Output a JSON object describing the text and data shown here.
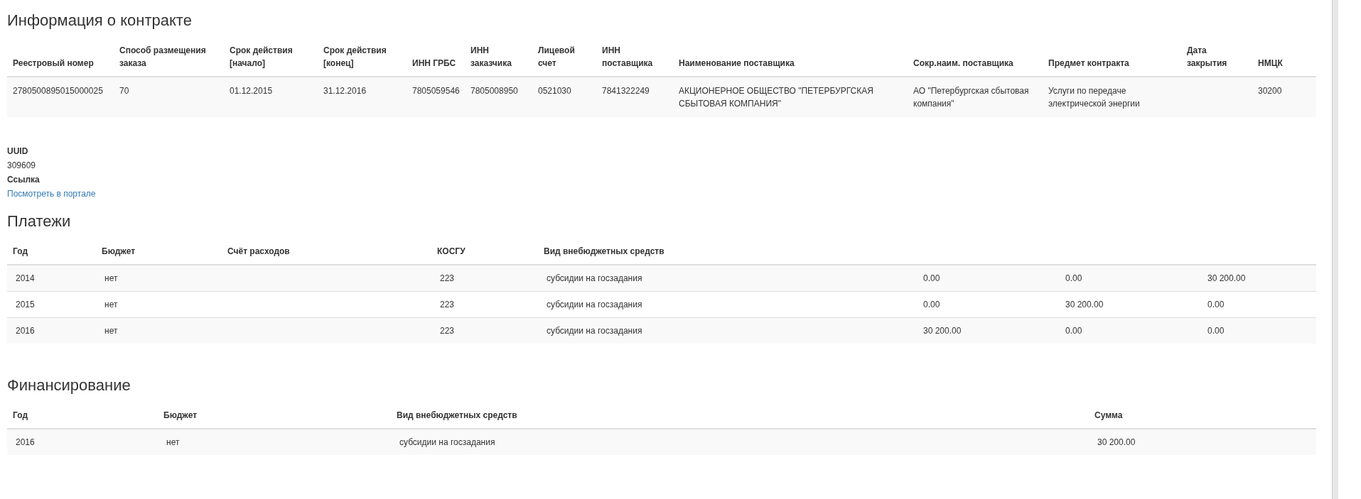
{
  "contract": {
    "title": "Информация о контракте",
    "columns": [
      "Реестровый номер",
      "Способ размещения заказа",
      "Срок действия [начало]",
      "Срок действия [конец]",
      "ИНН ГРБС",
      "ИНН заказчика",
      "Лицевой счет",
      "ИНН поставщика",
      "Наименование поставщика",
      "Сокр.наим. поставщика",
      "Предмет контракта",
      "Дата закрытия",
      "НМЦК"
    ],
    "rows": [
      {
        "registry_number": "2780500895015000025",
        "placement_method": "70",
        "start": "01.12.2015",
        "end": "31.12.2016",
        "inn_grbs": "7805059546",
        "inn_customer": "7805008950",
        "account": "0521030",
        "inn_supplier": "7841322249",
        "supplier_name": "АКЦИОНЕРНОЕ ОБЩЕСТВО \"ПЕТЕРБУРГСКАЯ СБЫТОВАЯ КОМПАНИЯ\"",
        "supplier_short": "АО \"Петербургская сбытовая компания\"",
        "subject": "Услуги по передаче электрической энергии",
        "nmck": "30200"
      }
    ]
  },
  "details": [
    {
      "label": "UUID",
      "value": "309609",
      "kind": "text"
    },
    {
      "label": "Ссылка",
      "value": "Посмотреть в портале",
      "kind": "link"
    }
  ],
  "payments": {
    "title": "Платежи",
    "columns": [
      "Год",
      "Бюджет",
      "Счёт расходов",
      "КОСГУ",
      "Вид внебюджетных средств"
    ],
    "rows": [
      {
        "year": "2014",
        "budget": "нет",
        "kosgu": "223",
        "fund_type": "субсидии на госзадания",
        "column_6": "0.00",
        "column_7": "0.00",
        "column_8": "30 200.00"
      },
      {
        "year": "2015",
        "budget": "нет",
        "kosgu": "223",
        "fund_type": "субсидии на госзадания",
        "column_6": "0.00",
        "column_7": "30 200.00",
        "column_8": "0.00"
      },
      {
        "year": "2016",
        "budget": "нет",
        "kosgu": "223",
        "fund_type": "субсидии на госзадания",
        "column_6": "30 200.00",
        "column_7": "0.00",
        "column_8": "0.00"
      }
    ]
  },
  "financing": {
    "title": "Финансирование",
    "columns": [
      "Год",
      "Бюджет",
      "Вид внебюджетных средств",
      "Сумма"
    ],
    "rows": [
      {
        "year": "2016",
        "budget": "нет",
        "fund_type": "субсидии на госзадания",
        "sum": "30 200.00"
      }
    ]
  }
}
